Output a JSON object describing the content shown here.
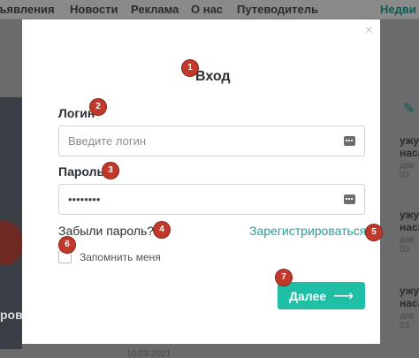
{
  "background": {
    "nav": [
      "ъявления",
      "Новости",
      "Реклама",
      "О нас",
      "Путеводитель",
      "Недви"
    ],
    "photo_text": "ров",
    "side_items": [
      {
        "title": "ужу\nнаса",
        "date": "дав\n03"
      },
      {
        "title": "ужу\nнаса",
        "date": "дав\n03"
      },
      {
        "title": "ужу\nнаса",
        "date": "дав\n03"
      }
    ],
    "bottom_date": "10.03.2021"
  },
  "modal": {
    "close_symbol": "×",
    "title": "Вход",
    "login_label": "Логин",
    "login_placeholder": "Введите логин",
    "password_label": "Пароль",
    "password_value": "••••••••",
    "forgot_link": "Забыли пароль?",
    "register_link": "Зарегистрироваться",
    "remember_label": "Запомнить меня",
    "submit_label": "Далее",
    "submit_arrow": "⟶"
  },
  "markers": [
    "1",
    "2",
    "3",
    "4",
    "5",
    "6",
    "7"
  ],
  "colors": {
    "accent": "#1fbfa6",
    "link": "#2a9d8f",
    "marker": "#c0392b"
  }
}
